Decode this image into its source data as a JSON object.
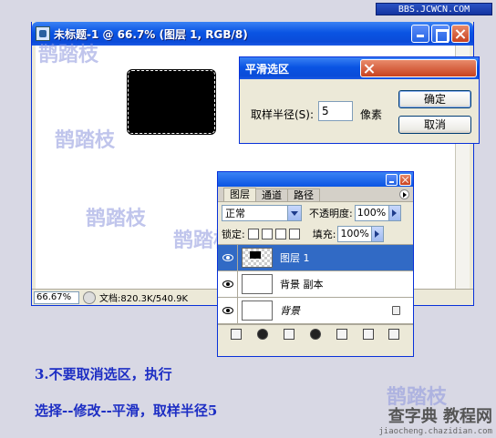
{
  "banner": {
    "text": "BBS.JCWCN.COM"
  },
  "doc_window": {
    "title": "未标题-1 @ 66.7% (图层 1, RGB/8)",
    "zoom": "66.67%",
    "doc_info": "文档:820.3K/540.9K"
  },
  "dialog": {
    "title": "平滑选区",
    "radius_label": "取样半径(S):",
    "radius_value": "5",
    "unit": "像素",
    "ok_label": "确定",
    "cancel_label": "取消"
  },
  "layers_palette": {
    "tabs": [
      {
        "label": "图层"
      },
      {
        "label": "通道"
      },
      {
        "label": "路径"
      }
    ],
    "blend_mode": "正常",
    "opacity_label": "不透明度:",
    "opacity_value": "100%",
    "lock_label": "锁定:",
    "fill_label": "填充:",
    "fill_value": "100%",
    "layers": [
      {
        "name": "图层 1"
      },
      {
        "name": "背景 副本"
      },
      {
        "name": "背景"
      }
    ]
  },
  "watermark": {
    "text": "鹊踏枝"
  },
  "instructions": {
    "line1": "3.不要取消选区，执行",
    "line2": "选择--修改--平滑，取样半径5"
  },
  "footer_logo": {
    "main": "查字典 教程网",
    "sub": "jiaocheng.chazidian.com"
  }
}
